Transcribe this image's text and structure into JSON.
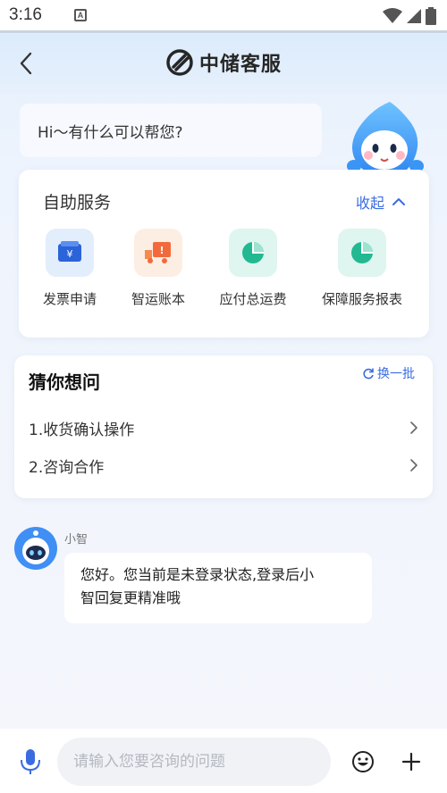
{
  "status_bar": {
    "time": "3:16",
    "notification_glyph": "A"
  },
  "header": {
    "title": "中储客服"
  },
  "greeting": {
    "text": "Hi～有什么可以帮您?"
  },
  "self_service": {
    "title": "自助服务",
    "collapse_label": "收起",
    "items": [
      {
        "label": "发票申请",
        "icon": "invoice-icon"
      },
      {
        "label": "智运账本",
        "icon": "truck-ledger-icon"
      },
      {
        "label": "应付总运费",
        "icon": "pie-chart-icon"
      },
      {
        "label": "保障服务报表",
        "icon": "pie-chart-icon"
      }
    ]
  },
  "guess": {
    "title": "猜你想问",
    "refresh_label": "换一批",
    "questions": [
      {
        "label": "1.收货确认操作"
      },
      {
        "label": "2.咨询合作"
      }
    ]
  },
  "chat": {
    "bot_name": "小智",
    "message_line1": "您好。您当前是未登录状态,登录后小",
    "message_line2": "智回复更精准哦"
  },
  "input": {
    "placeholder": "请输入您要咨询的问题"
  },
  "colors": {
    "accent": "#3a6ce0",
    "invoice_icon_bg": "#e3eefc",
    "truck_icon_bg": "#fdeee4",
    "pie_icon_bg": "#dff5f0",
    "pie_color": "#22b892",
    "truck_color": "#f26a3c"
  }
}
